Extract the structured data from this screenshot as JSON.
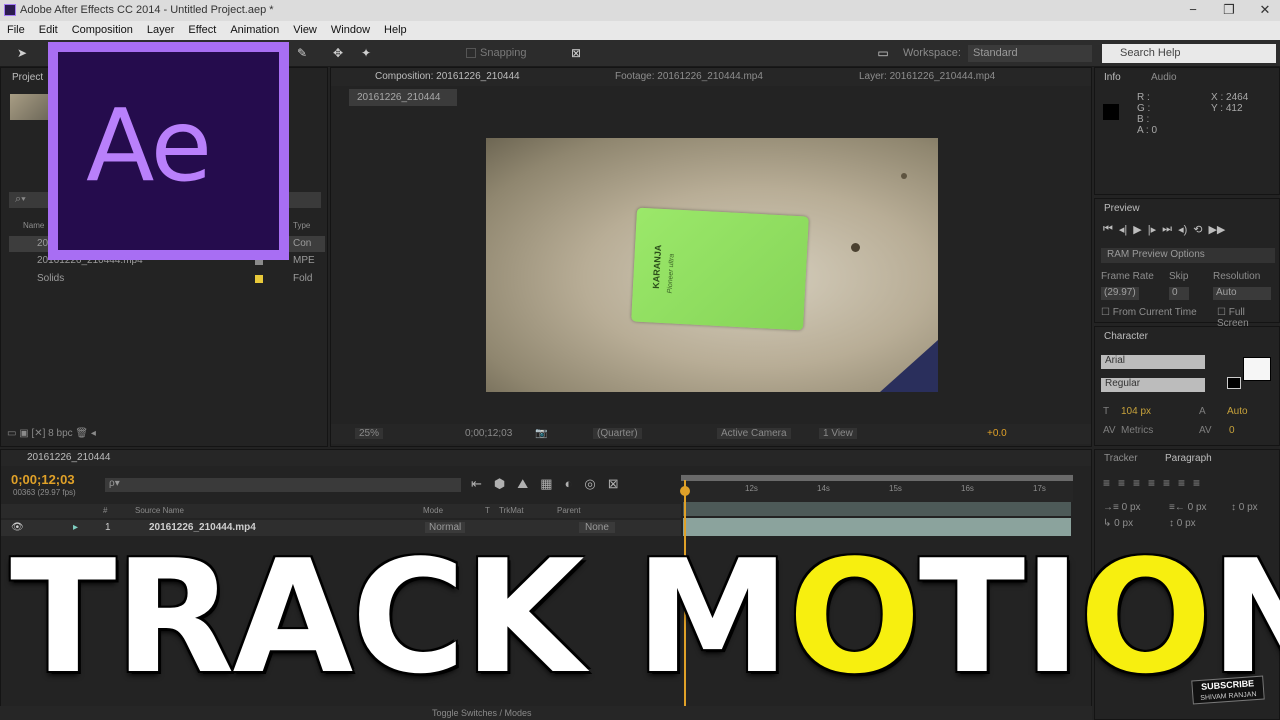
{
  "window": {
    "title": "Adobe After Effects CC 2014 - Untitled Project.aep *",
    "controls": [
      "−",
      "❐",
      "✕"
    ]
  },
  "menu": [
    "File",
    "Edit",
    "Composition",
    "Layer",
    "Effect",
    "Animation",
    "View",
    "Window",
    "Help"
  ],
  "toolbar": {
    "snapping_label": "Snapping",
    "workspace_label": "Workspace:",
    "workspace_value": "Standard",
    "search_help_placeholder": "Search Help"
  },
  "logo": {
    "text": "Ae"
  },
  "project_panel": {
    "tab": "Project",
    "col_name": "Name",
    "col_type": "Type",
    "items": [
      {
        "name": "20161226_210444",
        "type": "Con"
      },
      {
        "name": "20161226_210444.mp4",
        "type": "MPE"
      },
      {
        "name": "Solids",
        "type": "Fold"
      }
    ],
    "footer_bpc": "8 bpc"
  },
  "composition_panel": {
    "tab": "Composition: 20161226_210444",
    "footage_tab": "Footage: 20161226_210444.mp4",
    "layer_tab": "Layer: 20161226_210444.mp4",
    "comp_chip": "20161226_210444",
    "footer": {
      "zoom": "25%",
      "timecode": "0;00;12;03",
      "resolution": "(Quarter)",
      "camera": "Active Camera",
      "views": "1 View",
      "exposure": "+0.0"
    },
    "card_text_1": "KARANJA",
    "card_text_2": "Pioneer ultra"
  },
  "info_panel": {
    "tab": "Info",
    "audio_tab": "Audio",
    "rgb": [
      "R :",
      "G :",
      "B :",
      "A : 0"
    ],
    "x": "X : 2464",
    "y": "Y : 412"
  },
  "preview_panel": {
    "tab": "Preview",
    "ram_options": "RAM Preview Options",
    "frame_rate_label": "Frame Rate",
    "skip_label": "Skip",
    "resolution_label": "Resolution",
    "frame_rate_value": "(29.97)",
    "skip_value": "0",
    "resolution_value": "Auto",
    "from_current": "From Current Time",
    "full_screen": "Full Screen"
  },
  "character_panel": {
    "tab": "Character",
    "font": "Arial",
    "style": "Regular",
    "size": "104 px",
    "leading": "Auto",
    "kerning": "Metrics",
    "tracking": "0"
  },
  "paragraph_panel": {
    "tracker_tab": "Tracker",
    "paragraph_tab": "Paragraph",
    "indent_values": [
      "0 px",
      "0 px",
      "0 px",
      "0 px",
      "0 px"
    ]
  },
  "timeline": {
    "tab": "20161226_210444",
    "timecode": "0;00;12;03",
    "fps": "00363 (29.97 fps)",
    "search_placeholder": "ρ▾",
    "header": {
      "num": "#",
      "source": "Source Name",
      "mode": "Mode",
      "t": "T",
      "trkmat": "TrkMat",
      "parent": "Parent"
    },
    "layer": {
      "num": "1",
      "name": "20161226_210444.mp4",
      "mode": "Normal",
      "parent": "None"
    },
    "ruler_ticks": [
      "12s",
      "14s",
      "15s",
      "16s",
      "17s"
    ],
    "toggle_label": "Toggle Switches / Modes"
  },
  "overlay": {
    "text_1": "TRACK M",
    "text_o1": "O",
    "text_2": "TI",
    "text_o2": "O",
    "text_3": "N"
  },
  "subscribe": {
    "label": "SUBSCRIBE",
    "sub": "SHIVAM RANJAN"
  },
  "colors": {
    "accent_orange": "#e0a128",
    "logo_purple": "#a86ef3",
    "logo_bg": "#250c4d",
    "highlight_yellow": "#f7ef0f"
  }
}
